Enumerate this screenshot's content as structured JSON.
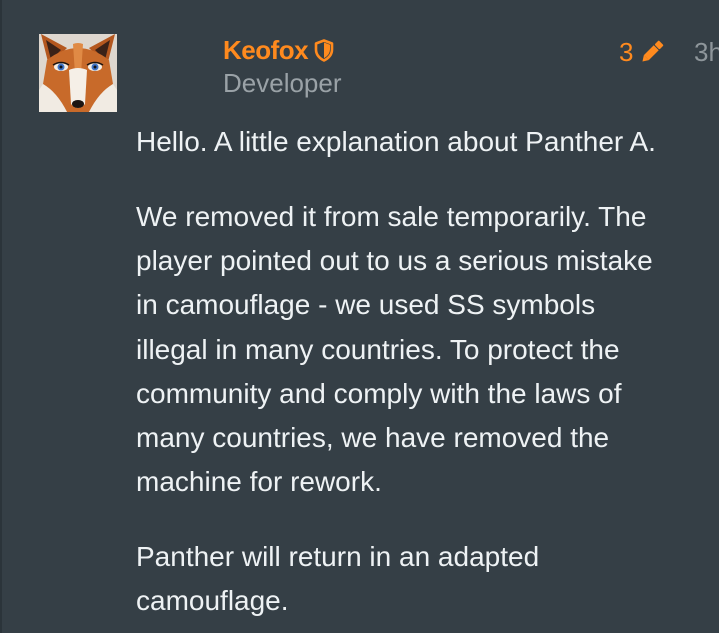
{
  "post": {
    "author": {
      "name": "Keofox",
      "role": "Developer",
      "avatar_icon": "fox-avatar",
      "badge_icon": "shield-icon",
      "name_color": "#ff8a1e"
    },
    "edit_count": "3",
    "edit_icon": "pencil-icon",
    "timestamp": "3h",
    "paragraphs": [
      {
        "lines": [
          "Hello. A little explanation about Panther A."
        ]
      },
      {
        "lines": [
          "We removed it from sale temporarily. The",
          "player pointed out to us a serious mistake",
          "in camouflage - we used SS symbols",
          "illegal in many countries. To protect the",
          "community and comply with the laws of",
          "many countries, we have removed the",
          "machine for rework."
        ]
      },
      {
        "lines": [
          "Panther will return in an adapted",
          "camouflage."
        ]
      }
    ]
  },
  "colors": {
    "background": "#353f46",
    "accent": "#ff8a1e",
    "text": "#eef2f4",
    "muted": "#9aa2a7"
  }
}
